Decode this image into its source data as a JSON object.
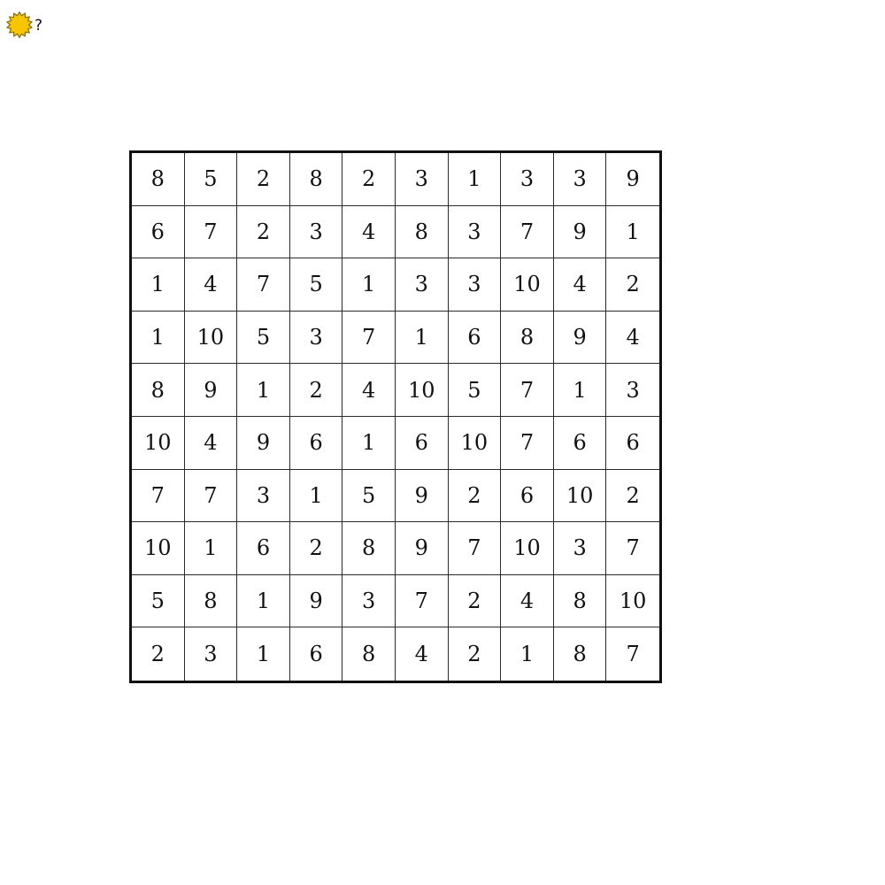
{
  "help": {
    "icon": "sun-icon",
    "mark": "?"
  },
  "colors": {
    "sun_fill": "#f7c600",
    "sun_stroke": "#8a6a00",
    "grid_border": "#111111",
    "cell_line": "#2a2a2a",
    "text": "#111111"
  },
  "grid": {
    "rows": 10,
    "cols": 10,
    "cells": [
      [
        "8",
        "5",
        "2",
        "8",
        "2",
        "3",
        "1",
        "3",
        "3",
        "9"
      ],
      [
        "6",
        "7",
        "2",
        "3",
        "4",
        "8",
        "3",
        "7",
        "9",
        "1"
      ],
      [
        "1",
        "4",
        "7",
        "5",
        "1",
        "3",
        "3",
        "10",
        "4",
        "2"
      ],
      [
        "1",
        "10",
        "5",
        "3",
        "7",
        "1",
        "6",
        "8",
        "9",
        "4"
      ],
      [
        "8",
        "9",
        "1",
        "2",
        "4",
        "10",
        "5",
        "7",
        "1",
        "3"
      ],
      [
        "10",
        "4",
        "9",
        "6",
        "1",
        "6",
        "10",
        "7",
        "6",
        "6"
      ],
      [
        "7",
        "7",
        "3",
        "1",
        "5",
        "9",
        "2",
        "6",
        "10",
        "2"
      ],
      [
        "10",
        "1",
        "6",
        "2",
        "8",
        "9",
        "7",
        "10",
        "3",
        "7"
      ],
      [
        "5",
        "8",
        "1",
        "9",
        "3",
        "7",
        "2",
        "4",
        "8",
        "10"
      ],
      [
        "2",
        "3",
        "1",
        "6",
        "8",
        "4",
        "2",
        "1",
        "8",
        "7"
      ]
    ]
  }
}
